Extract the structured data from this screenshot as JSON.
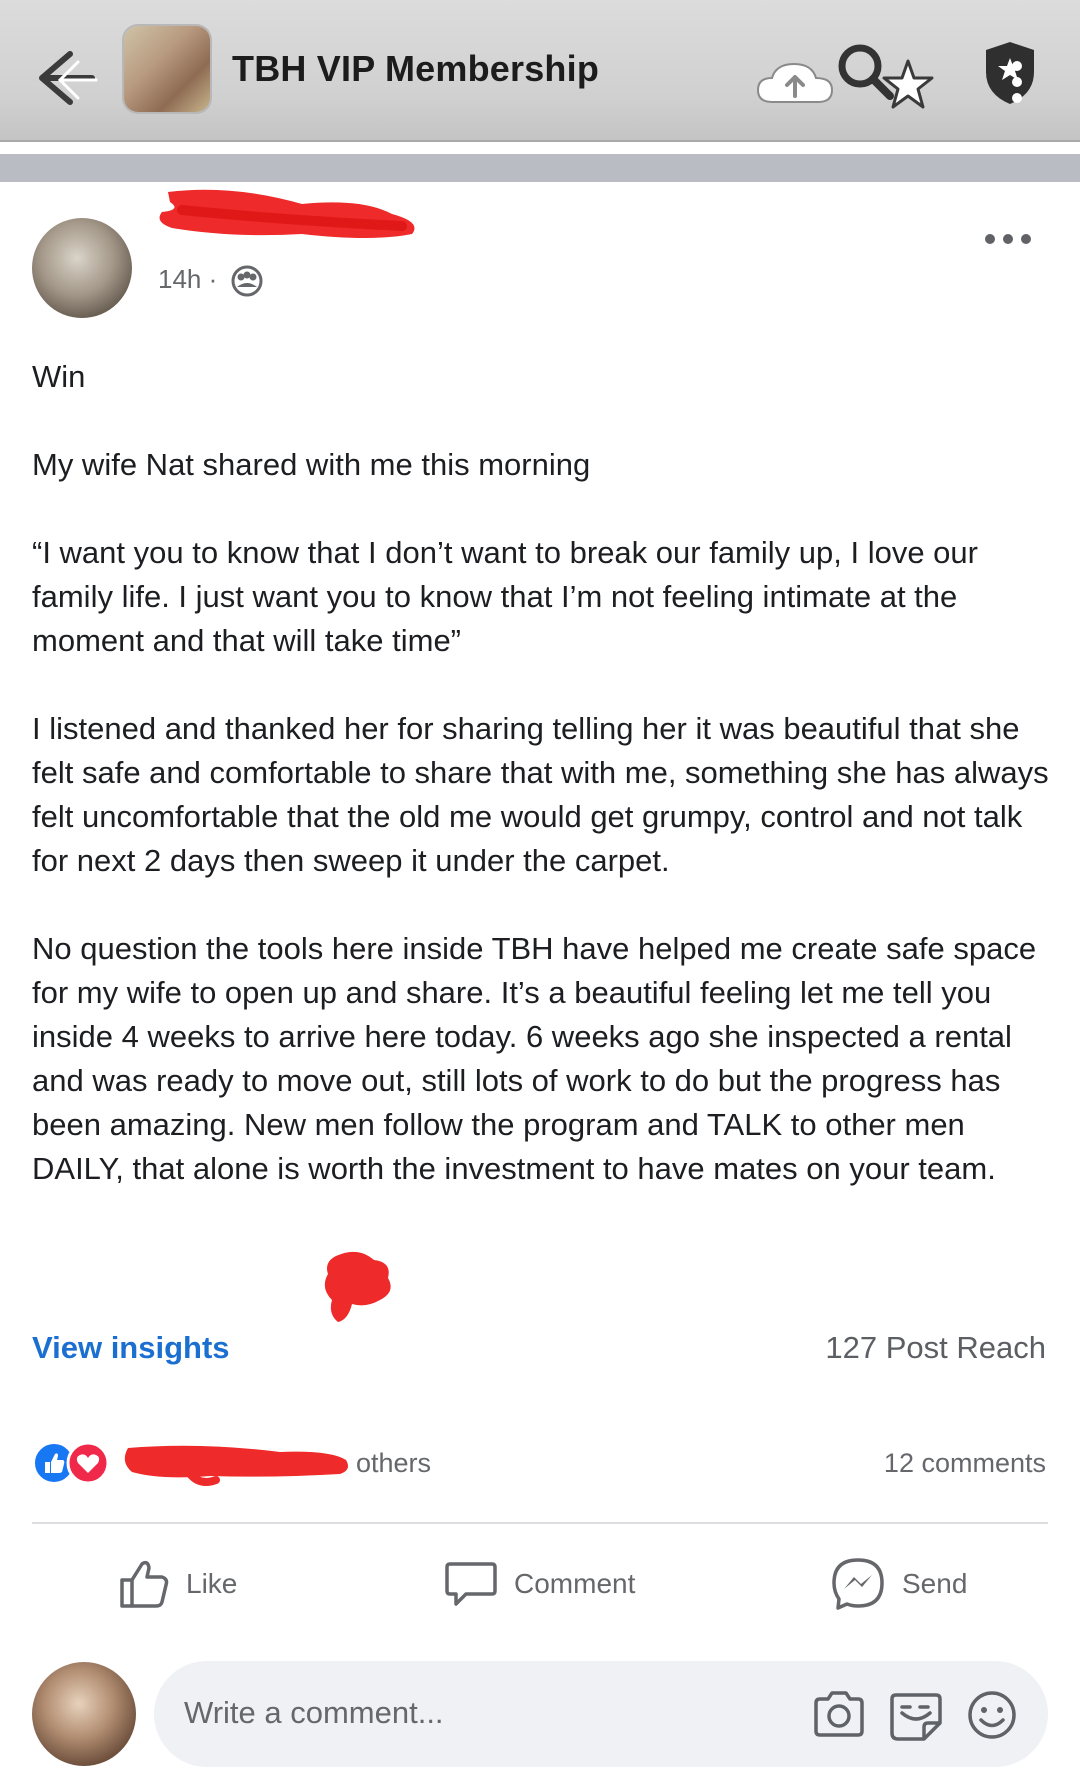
{
  "header": {
    "group_title": "TBH VIP Membership",
    "icons": [
      "back-arrow-icon",
      "cloud-upload-icon",
      "search-icon",
      "star-icon",
      "shield-icon",
      "more-vertical-icon"
    ]
  },
  "post": {
    "author_name": "",
    "timestamp": "14h ·",
    "audience_icon": "group-audience-icon",
    "more_icon": "more-horizontal-icon",
    "paragraphs": [
      "Win",
      "My wife Nat shared with me this morning",
      "“I want you to know that I don’t want to break our family up, I love our family life. I just want you to know that I’m not feeling intimate at the moment and that will take time”",
      "I listened and thanked her for sharing telling her it was beautiful that she felt safe and comfortable to share that with me, something she has always felt uncomfortable that the old me would get grumpy, control and not talk for next 2 days then sweep it under the carpet.",
      "No question the tools here inside TBH have helped me create safe space for my wife to open up and share. It’s a beautiful feeling let me tell you inside 4 weeks to arrive here today. 6 weeks ago she inspected a rental and was ready to move out, still lots of work to do but the progress has been amazing. New men follow the program and TALK to other men DAILY, that alone is worth the investment to have    mates on your team."
    ]
  },
  "insights": {
    "link_label": "View insights",
    "reach": "127 Post Reach"
  },
  "reactions": {
    "types": [
      "like",
      "love"
    ],
    "others_text": "others",
    "comments": "12 comments"
  },
  "actions": {
    "like": "Like",
    "comment": "Comment",
    "send": "Send"
  },
  "composer": {
    "placeholder": "Write a comment...",
    "icons": [
      "camera-icon",
      "sticker-icon",
      "emoji-icon"
    ]
  },
  "colors": {
    "accent_blue": "#1b6fd1",
    "redaction_red": "#ee2a2a",
    "like_blue": "#1877f2",
    "love_red": "#f02849",
    "topbar_gray": "#d0d0d0"
  }
}
